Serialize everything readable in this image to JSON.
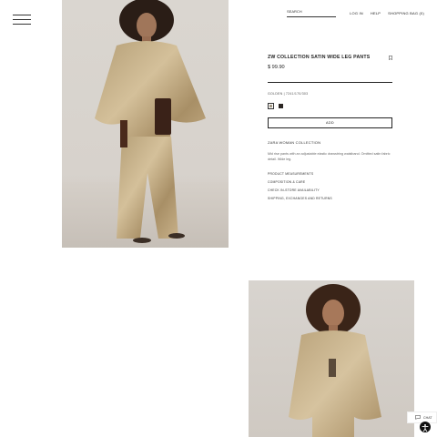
{
  "header": {
    "search_placeholder": "SEARCH",
    "links": {
      "login": "LOG IN",
      "help": "HELP",
      "bag": "SHOPPING BAG (0)"
    }
  },
  "product": {
    "name": "ZW COLLECTION SATIN WIDE LEG PANTS",
    "price": "$ 99.90",
    "color_ref": "GOLDEN | 7241/170/303",
    "colors": [
      {
        "name": "golden",
        "hex": "#a49a86",
        "selected": true
      },
      {
        "name": "dark",
        "hex": "#2b2623",
        "selected": false
      }
    ],
    "add_label": "ADD",
    "collection": "ZARA WOMAN COLLECTION",
    "description": "Mid rise pants with an adjustable elastic drawstring waistband. Omitted satin fabric detail. Wide leg.",
    "links": [
      "PRODUCT MEASUREMENTS",
      "COMPOSITION & CARE",
      "CHECK IN-STORE AVAILABILITY",
      "SHIPPING, EXCHANGES AND RETURNS"
    ]
  },
  "chat": {
    "label": "CHAT"
  },
  "icons": [
    "menu-icon",
    "bookmark-icon",
    "chat-icon",
    "accessibility-icon"
  ]
}
